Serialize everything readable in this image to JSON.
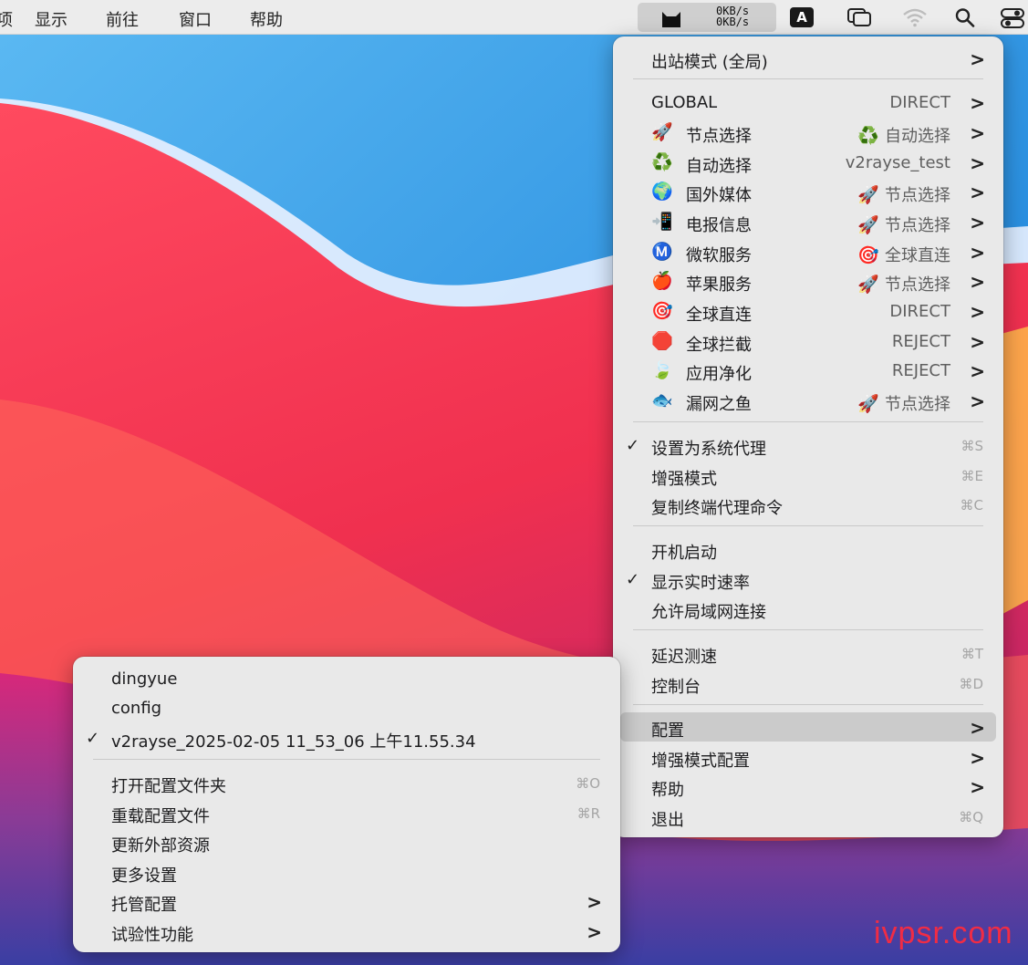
{
  "menubar": {
    "partial_item": "项",
    "items": [
      "显示",
      "前往",
      "窗口",
      "帮助"
    ],
    "upload_speed": "0KB/s",
    "download_speed": "0KB/s",
    "input_method": "A"
  },
  "main_menu": {
    "outbound_mode": "出站模式 (全局)",
    "global": {
      "label": "GLOBAL",
      "value": "DIRECT"
    },
    "proxy_groups": [
      {
        "icon": "rocket",
        "label": "节点选择",
        "value_icon": "recycle",
        "value": "自动选择"
      },
      {
        "icon": "recycle",
        "label": "自动选择",
        "value_icon": "",
        "value": "v2rayse_test"
      },
      {
        "icon": "globe",
        "label": "国外媒体",
        "value_icon": "rocket",
        "value": "节点选择"
      },
      {
        "icon": "phone",
        "label": "电报信息",
        "value_icon": "rocket",
        "value": "节点选择"
      },
      {
        "icon": "m-circle",
        "label": "微软服务",
        "value_icon": "target",
        "value": "全球直连"
      },
      {
        "icon": "apple",
        "label": "苹果服务",
        "value_icon": "rocket",
        "value": "节点选择"
      },
      {
        "icon": "target",
        "label": "全球直连",
        "value_icon": "",
        "value": "DIRECT"
      },
      {
        "icon": "stop",
        "label": "全球拦截",
        "value_icon": "",
        "value": "REJECT"
      },
      {
        "icon": "leaf",
        "label": "应用净化",
        "value_icon": "",
        "value": "REJECT"
      },
      {
        "icon": "fish",
        "label": "漏网之鱼",
        "value_icon": "rocket",
        "value": "节点选择"
      }
    ],
    "set_system_proxy": {
      "label": "设置为系统代理",
      "checked": true,
      "shortcut": "⌘S"
    },
    "enhanced_mode": {
      "label": "增强模式",
      "shortcut": "⌘E"
    },
    "copy_terminal": {
      "label": "复制终端代理命令",
      "shortcut": "⌘C"
    },
    "launch_at_login": {
      "label": "开机启动"
    },
    "show_speed": {
      "label": "显示实时速率",
      "checked": true
    },
    "allow_lan": {
      "label": "允许局域网连接"
    },
    "latency_test": {
      "label": "延迟测速",
      "shortcut": "⌘T"
    },
    "dashboard": {
      "label": "控制台",
      "shortcut": "⌘D"
    },
    "config": {
      "label": "配置"
    },
    "enhanced_config": {
      "label": "增强模式配置"
    },
    "help": {
      "label": "帮助"
    },
    "quit": {
      "label": "退出",
      "shortcut": "⌘Q"
    }
  },
  "config_submenu": {
    "profiles": [
      {
        "label": "dingyue",
        "checked": false
      },
      {
        "label": "config",
        "checked": false
      },
      {
        "label": "v2rayse_2025-02-05 11_53_06 上午11.55.34",
        "checked": true
      }
    ],
    "open_folder": {
      "label": "打开配置文件夹",
      "shortcut": "⌘O"
    },
    "reload": {
      "label": "重载配置文件",
      "shortcut": "⌘R"
    },
    "update_resources": {
      "label": "更新外部资源"
    },
    "more_settings": {
      "label": "更多设置"
    },
    "managed_config": {
      "label": "托管配置"
    },
    "experimental": {
      "label": "试验性功能"
    }
  },
  "check_glyph": "✓",
  "chevron_glyph": ">",
  "icon_glyphs": {
    "rocket": "🚀",
    "recycle": "♻️",
    "globe": "🌍",
    "phone": "📲",
    "m-circle": "Ⓜ️",
    "apple": "🍎",
    "target": "🎯",
    "stop": "🛑",
    "leaf": "🍃",
    "fish": "🐟"
  },
  "watermark": "ivpsr.com"
}
